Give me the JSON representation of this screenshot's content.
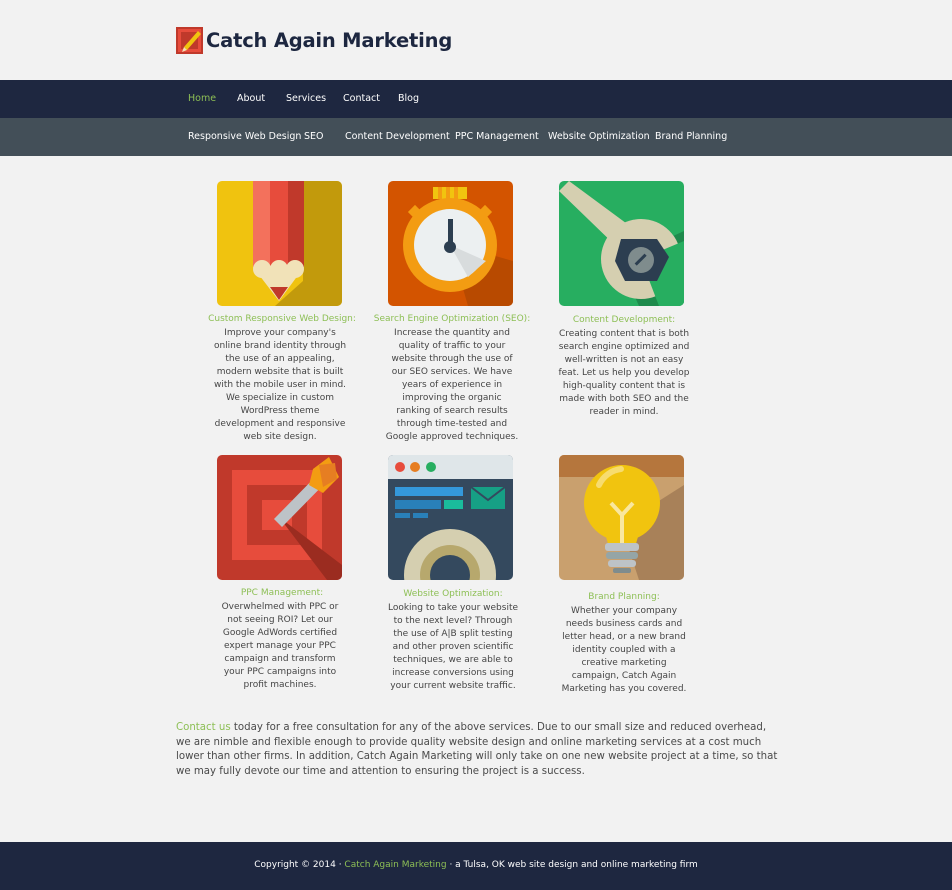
{
  "site": {
    "logo_text": "Catch Again Marketing"
  },
  "nav": {
    "main": [
      {
        "label": "Home",
        "active": true
      },
      {
        "label": "About"
      },
      {
        "label": "Services"
      },
      {
        "label": "Contact"
      },
      {
        "label": "Blog"
      }
    ],
    "sub": [
      {
        "label": "Responsive Web Design"
      },
      {
        "label": "SEO"
      },
      {
        "label": "Content Development"
      },
      {
        "label": "PPC Management"
      },
      {
        "label": "Website Optimization"
      },
      {
        "label": "Brand Planning"
      }
    ]
  },
  "services": [
    {
      "icon": "pencil-icon",
      "title": "Custom Responsive Web Design:",
      "description": "Improve your company's online brand identity through the use of an appealing, modern website that is built with the mobile user in mind. We specialize in custom WordPress theme development and responsive web site design."
    },
    {
      "icon": "stopwatch-icon",
      "title": "Search Engine Optimization (SEO):",
      "description": "Increase the quantity and quality of traffic to your website through the use of our SEO services. We have years of experience in improving the organic ranking of search results through time-tested and Google approved techniques."
    },
    {
      "icon": "wrench-icon",
      "title": "Content Development:",
      "description": "Creating content that is both search engine optimized and well-written is not an easy feat. Let us help you develop high-quality content that is made with both SEO and the reader in mind."
    },
    {
      "icon": "target-icon",
      "title": "PPC Management:",
      "description": "Overwhelmed with PPC or not seeing ROI? Let our Google AdWords certified expert manage your PPC campaign and transform your PPC campaigns into profit machines."
    },
    {
      "icon": "browser-gear-icon",
      "title": "Website Optimization:",
      "description": "Looking to take your website to the next level? Through the use of A|B split testing and other proven scientific techniques, we are able to increase conversions using your current website traffic."
    },
    {
      "icon": "lightbulb-icon",
      "title": "Brand Planning:",
      "description": "Whether your company needs business cards and letter head, or a new brand identity coupled with a creative marketing campaign, Catch Again Marketing has you covered."
    }
  ],
  "cta": {
    "link_text": "Contact us",
    "text": " today for a free consultation for any of the above services. Due to our small size and reduced overhead, we are nimble and flexible enough to provide quality website design and online marketing services at a cost much lower than other firms. In addition, Catch Again Marketing will only take on one new website project at a time, so that we may fully devote our time and attention to ensuring the project is a success."
  },
  "footer": {
    "prefix": "Copyright © 2014 · ",
    "link_text": "Catch Again Marketing",
    "suffix": " · a Tulsa, OK web site design and online marketing firm"
  },
  "colors": {
    "accent_green": "#8dbf55",
    "nav_dark": "#1e2740",
    "nav_sub": "#434f58",
    "background": "#f2f2f2"
  }
}
